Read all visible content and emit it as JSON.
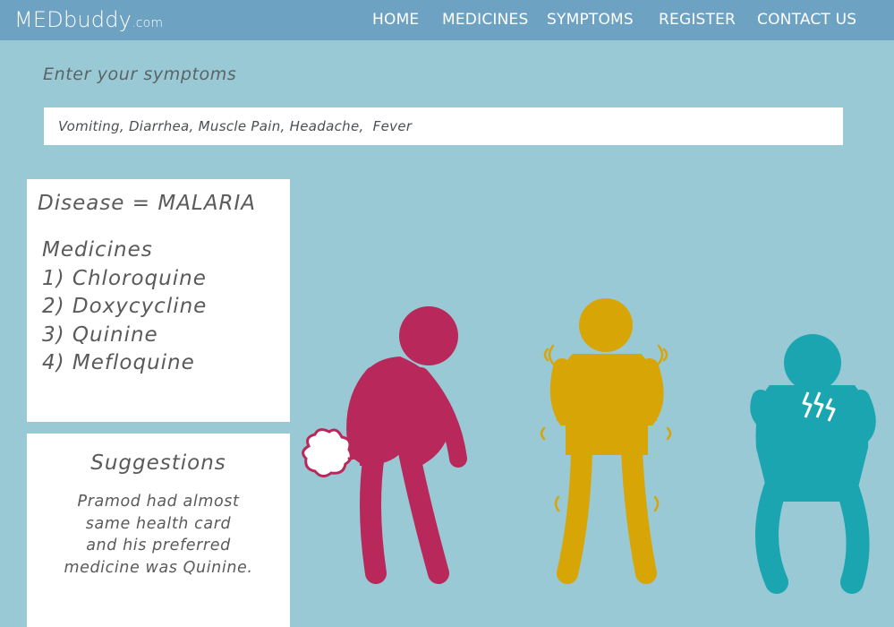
{
  "header": {
    "logo_main": "MEDbuddy",
    "logo_suffix": ".com",
    "nav": [
      "HOME",
      "MEDICINES",
      "SYMPTOMS",
      "REGISTER",
      "CONTACT US"
    ]
  },
  "symptoms": {
    "prompt": "Enter your symptoms",
    "value": "Vomiting, Diarrhea, Muscle Pain, Headache,  Fever"
  },
  "result": {
    "disease": "Disease = MALARIA",
    "medicines_heading": "Medicines",
    "medicines": [
      "1) Chloroquine",
      "2) Doxycycline",
      "3) Quinine",
      "4) Mefloquine"
    ]
  },
  "suggestions": {
    "title": "Suggestions",
    "text": "Pramod had almost\nsame health card\nand his preferred\nmedicine was Quinine."
  },
  "illustration": {
    "figures": [
      "diarrhea-figure",
      "shivering-figure",
      "stomach-pain-figure"
    ],
    "colors": {
      "figure1": "#b9285a",
      "figure2": "#d8a507",
      "figure3": "#1aa5b0"
    }
  }
}
